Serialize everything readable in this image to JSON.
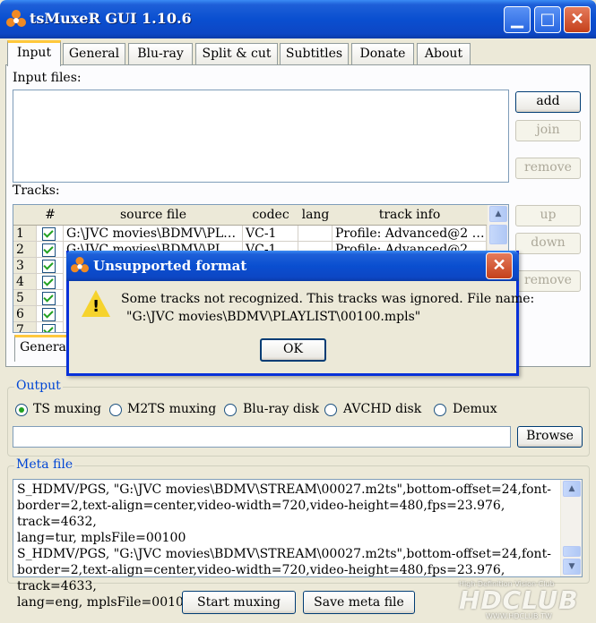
{
  "window": {
    "title": "tsMuxeR GUI 1.10.6",
    "minimize_glyph": "▁",
    "maximize_glyph": "□",
    "close_glyph": "✕"
  },
  "tabs": [
    {
      "label": "Input",
      "active": true
    },
    {
      "label": "General"
    },
    {
      "label": "Blu-ray"
    },
    {
      "label": "Split & cut"
    },
    {
      "label": "Subtitles"
    },
    {
      "label": "Donate"
    },
    {
      "label": "About"
    }
  ],
  "input": {
    "files_label": "Input files:",
    "tracks_label": "Tracks:",
    "buttons": {
      "add": "add",
      "join": "join",
      "remove_file": "remove",
      "up": "up",
      "down": "down",
      "remove_track": "remove"
    }
  },
  "tracks": {
    "columns": [
      "#",
      "source file",
      "codec",
      "lang",
      "track info"
    ],
    "rows": [
      {
        "index": "1",
        "source": "G:\\JVC movies\\BDMV\\PL…",
        "codec": "VC-1",
        "lang": "",
        "info": "Profile: Advanced@2 …"
      },
      {
        "index": "2",
        "source": "G:\\JVC movies\\BDMV\\PL…",
        "codec": "VC-1",
        "lang": "",
        "info": "Profile: Advanced@2 …"
      },
      {
        "index": "3"
      },
      {
        "index": "4"
      },
      {
        "index": "5"
      },
      {
        "index": "6"
      },
      {
        "index": "7"
      }
    ],
    "subtab_label": "Genera"
  },
  "dialog": {
    "title": "Unsupported format",
    "message_line1": "Some tracks not recognized. This tracks was ignored. File name:",
    "message_line2": "\"G:\\JVC movies\\BDMV\\PLAYLIST\\00100.mpls\"",
    "ok_label": "OK",
    "icon": "warning-icon"
  },
  "output": {
    "group_label": "Output",
    "modes": [
      {
        "label": "TS muxing",
        "selected": true
      },
      {
        "label": "M2TS muxing"
      },
      {
        "label": "Blu-ray disk"
      },
      {
        "label": "AVCHD disk"
      },
      {
        "label": "Demux"
      }
    ],
    "path_value": "",
    "browse_label": "Browse"
  },
  "meta": {
    "group_label": "Meta file",
    "text": "S_HDMV/PGS, \"G:\\JVC movies\\BDMV\\STREAM\\00027.m2ts\",bottom-offset=24,font-\nborder=2,text-align=center,video-width=720,video-height=480,fps=23.976, track=4632,\nlang=tur, mplsFile=00100\nS_HDMV/PGS, \"G:\\JVC movies\\BDMV\\STREAM\\00027.m2ts\",bottom-offset=24,font-\nborder=2,text-align=center,video-width=720,video-height=480,fps=23.976, track=4633,\nlang=eng, mplsFile=00100"
  },
  "actions": {
    "start": "Start muxing",
    "save_meta": "Save meta file"
  },
  "watermark": {
    "logo": "HDCLUB",
    "tagline": "High Definition Vision Club",
    "url": "WWW.HDCLUB.TW"
  }
}
